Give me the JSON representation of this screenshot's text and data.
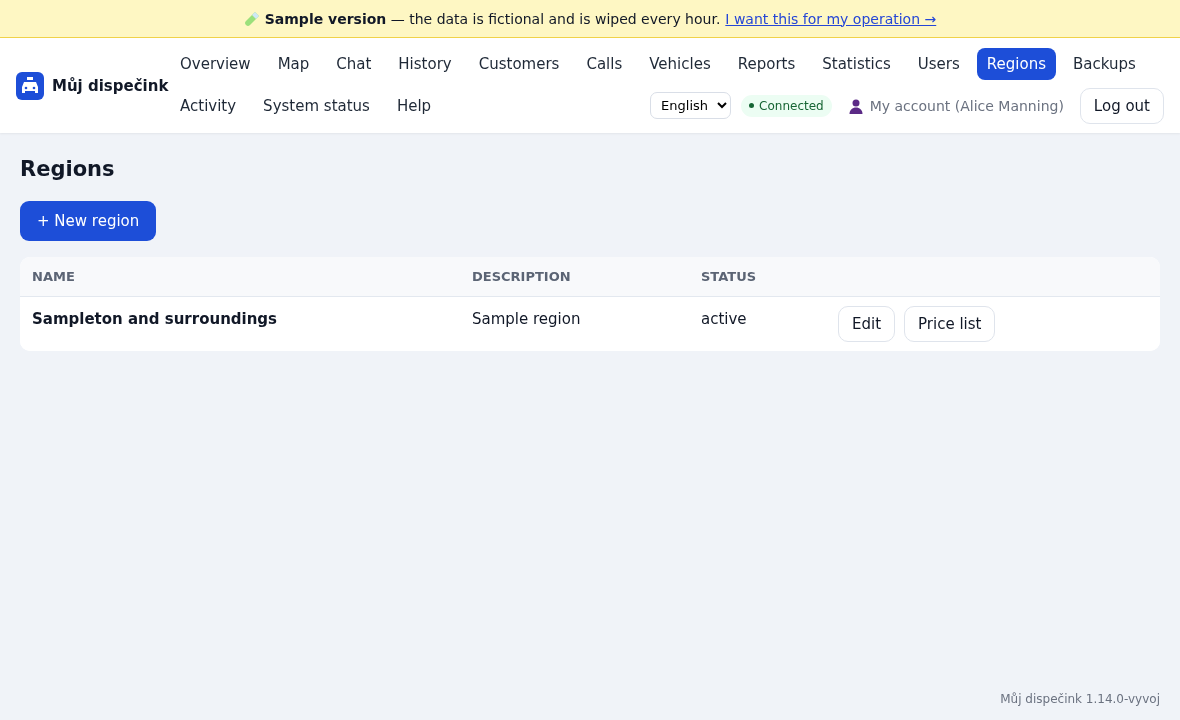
{
  "banner": {
    "text": "**Sample version** — the data is fictional and is wiped every hour.",
    "link": "I want this for my operation →"
  },
  "brand": {
    "name": "Můj dispečink"
  },
  "nav": [
    {
      "label": "Overview",
      "selected": false
    },
    {
      "label": "Map",
      "selected": false
    },
    {
      "label": "Chat",
      "selected": false
    },
    {
      "label": "History",
      "selected": false
    },
    {
      "label": "Customers",
      "selected": false
    },
    {
      "label": "Calls",
      "selected": false
    },
    {
      "label": "Vehicles",
      "selected": false
    },
    {
      "label": "Reports",
      "selected": false
    },
    {
      "label": "Statistics",
      "selected": false
    },
    {
      "label": "Users",
      "selected": false
    },
    {
      "label": "Regions",
      "selected": true
    },
    {
      "label": "Backups",
      "selected": false
    },
    {
      "label": "Activity",
      "selected": false
    },
    {
      "label": "System status",
      "selected": false
    },
    {
      "label": "Help",
      "selected": false
    }
  ],
  "language": {
    "value": "English"
  },
  "connection": {
    "label": "Connected",
    "connected": true
  },
  "account": {
    "label": "My account (Alice Manning)"
  },
  "logout": "Log out",
  "page": {
    "title": "Regions",
    "new_button": "+ New region"
  },
  "table": {
    "columns": [
      "NAME",
      "DESCRIPTION",
      "STATUS"
    ],
    "rows": [
      {
        "name": "Sampleton and surroundings",
        "description": "Sample region",
        "status": "active",
        "actions": [
          "Edit",
          "Price list"
        ]
      }
    ]
  },
  "footer": "Můj dispečink 1.14.0-vyvoj"
}
